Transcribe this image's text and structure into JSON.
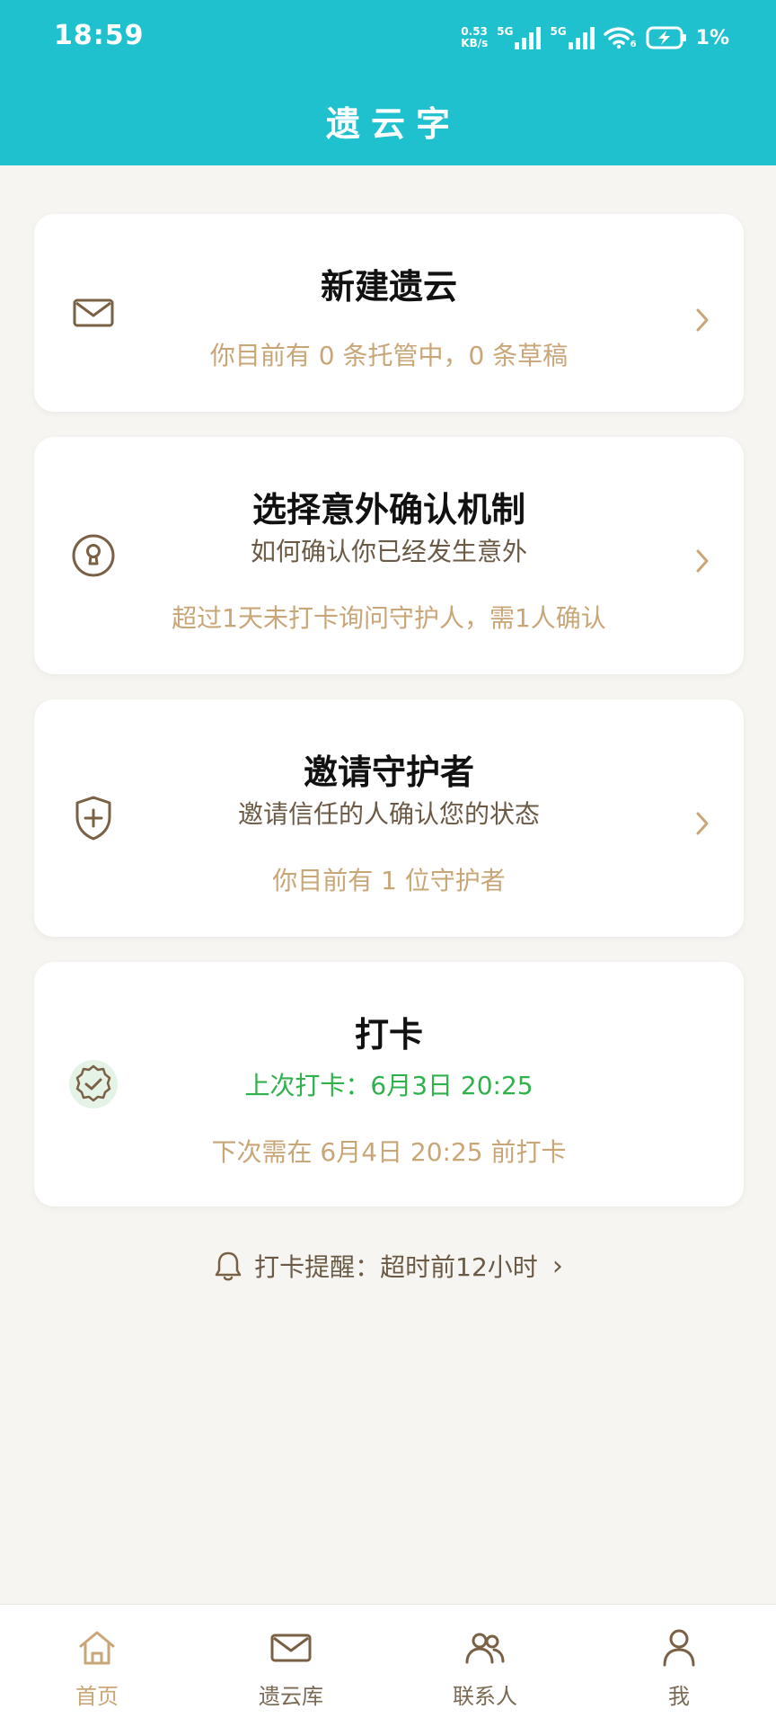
{
  "status_bar": {
    "time": "18:59",
    "net_speed_value": "0.53",
    "net_speed_unit": "KB/s",
    "sim1_tag": "5G",
    "sim2_tag": "5G",
    "wifi_tag": "6",
    "battery": "1%"
  },
  "header": {
    "title": "遗云字"
  },
  "cards": [
    {
      "title": "新建遗云",
      "note": "你目前有 0 条托管中，0 条草稿",
      "icon": "envelope-icon"
    },
    {
      "title": "选择意外确认机制",
      "subtitle": "如何确认你已经发生意外",
      "note": "超过1天未打卡询问守护人，需1人确认",
      "icon": "keyhole-icon"
    },
    {
      "title": "邀请守护者",
      "subtitle": "邀请信任的人确认您的状态",
      "note": "你目前有 1 位守护者",
      "icon": "shield-plus-icon"
    },
    {
      "title": "打卡",
      "last_checkin": "上次打卡：6月3日 20:25",
      "next_checkin": "下次需在 6月4日 20:25 前打卡",
      "icon": "verified-badge-icon"
    }
  ],
  "reminder": {
    "text": "打卡提醒：超时前12小时",
    "chevron": "›"
  },
  "bottom_nav": [
    {
      "label": "首页",
      "icon": "home-icon",
      "active": true
    },
    {
      "label": "遗云库",
      "icon": "envelope-icon",
      "active": false
    },
    {
      "label": "联系人",
      "icon": "contacts-icon",
      "active": false
    },
    {
      "label": "我",
      "icon": "person-icon",
      "active": false
    }
  ],
  "colors": {
    "header_bg": "#1fc1cf",
    "page_bg": "#f6f5f1",
    "accent_gold": "#c9a677",
    "brown_text": "#6b5a45",
    "icon_brown": "#7a6045",
    "checkin_green": "#2fb14b"
  }
}
